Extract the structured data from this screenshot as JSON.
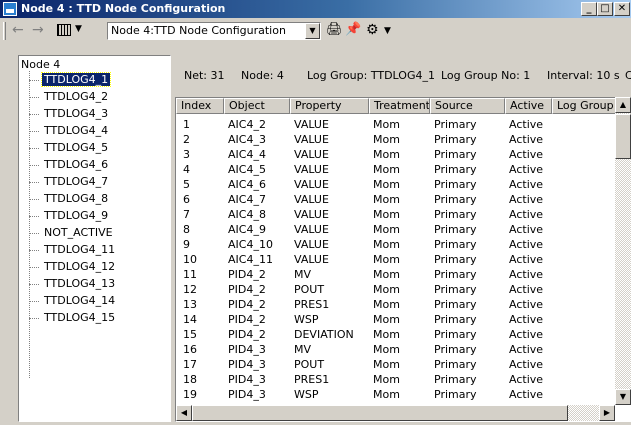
{
  "window": {
    "title": "Node 4 : TTD Node Configuration",
    "minimize_glyph": "_",
    "maximize_glyph": "□",
    "close_glyph": "✕"
  },
  "toolbar": {
    "back_icon": "←",
    "forward_icon": "→",
    "node_select_value": "Node 4:TTD Node Configuration",
    "dropdown_glyph": "▼",
    "print_icon": "🖨",
    "pin_icon": "📌",
    "gear_icon": "⚙"
  },
  "tree": {
    "root": "Node 4",
    "selected_index": 0,
    "items": [
      "TTDLOG4_1",
      "TTDLOG4_2",
      "TTDLOG4_3",
      "TTDLOG4_4",
      "TTDLOG4_5",
      "TTDLOG4_6",
      "TTDLOG4_7",
      "TTDLOG4_8",
      "TTDLOG4_9",
      "NOT_ACTIVE",
      "TTDLOG4_11",
      "TTDLOG4_12",
      "TTDLOG4_13",
      "TTDLOG4_14",
      "TTDLOG4_15"
    ]
  },
  "info": {
    "net": "Net: 31",
    "node": "Node: 4",
    "log_group": "Log Group: TTDLOG4_1",
    "log_group_no": "Log Group No: 1",
    "interval": "Interval: 10 s",
    "extra": "C"
  },
  "table": {
    "columns": [
      "Index",
      "Object",
      "Property",
      "Treatment",
      "Source",
      "Active",
      "Log Group"
    ],
    "rows": [
      [
        "1",
        "AIC4_2",
        "VALUE",
        "Mom",
        "Primary",
        "Active"
      ],
      [
        "2",
        "AIC4_3",
        "VALUE",
        "Mom",
        "Primary",
        "Active"
      ],
      [
        "3",
        "AIC4_4",
        "VALUE",
        "Mom",
        "Primary",
        "Active"
      ],
      [
        "4",
        "AIC4_5",
        "VALUE",
        "Mom",
        "Primary",
        "Active"
      ],
      [
        "5",
        "AIC4_6",
        "VALUE",
        "Mom",
        "Primary",
        "Active"
      ],
      [
        "6",
        "AIC4_7",
        "VALUE",
        "Mom",
        "Primary",
        "Active"
      ],
      [
        "7",
        "AIC4_8",
        "VALUE",
        "Mom",
        "Primary",
        "Active"
      ],
      [
        "8",
        "AIC4_9",
        "VALUE",
        "Mom",
        "Primary",
        "Active"
      ],
      [
        "9",
        "AIC4_10",
        "VALUE",
        "Mom",
        "Primary",
        "Active"
      ],
      [
        "10",
        "AIC4_11",
        "VALUE",
        "Mom",
        "Primary",
        "Active"
      ],
      [
        "11",
        "PID4_2",
        "MV",
        "Mom",
        "Primary",
        "Active"
      ],
      [
        "12",
        "PID4_2",
        "POUT",
        "Mom",
        "Primary",
        "Active"
      ],
      [
        "13",
        "PID4_2",
        "PRES1",
        "Mom",
        "Primary",
        "Active"
      ],
      [
        "14",
        "PID4_2",
        "WSP",
        "Mom",
        "Primary",
        "Active"
      ],
      [
        "15",
        "PID4_2",
        "DEVIATION",
        "Mom",
        "Primary",
        "Active"
      ],
      [
        "16",
        "PID4_3",
        "MV",
        "Mom",
        "Primary",
        "Active"
      ],
      [
        "17",
        "PID4_3",
        "POUT",
        "Mom",
        "Primary",
        "Active"
      ],
      [
        "18",
        "PID4_3",
        "PRES1",
        "Mom",
        "Primary",
        "Active"
      ],
      [
        "19",
        "PID4_3",
        "WSP",
        "Mom",
        "Primary",
        "Active"
      ]
    ]
  },
  "scroll": {
    "up": "▲",
    "down": "▼",
    "left": "◀",
    "right": "▶"
  },
  "colors": {
    "title_start": "#0a246a",
    "title_end": "#a6caf0",
    "selection": "#0a246a",
    "face": "#d4d0c8"
  }
}
